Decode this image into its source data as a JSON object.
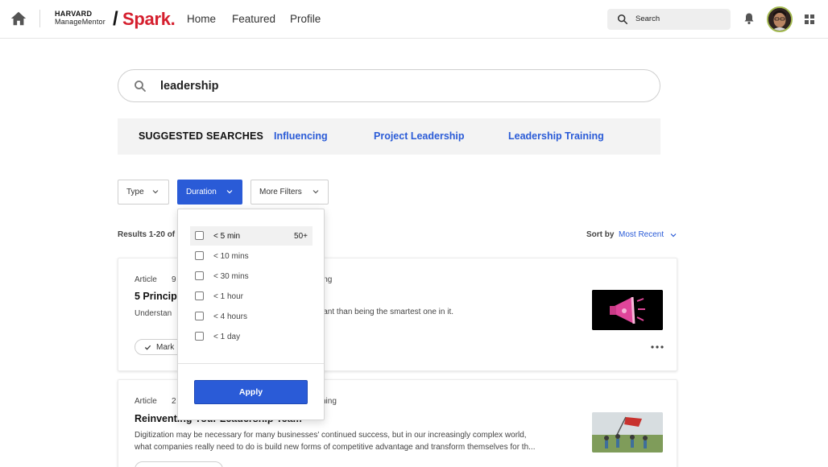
{
  "header": {
    "brand_harvard": "HARVARD",
    "brand_managementor": "ManageMentor",
    "brand_slash": "/",
    "brand_spark": "Spark.",
    "nav": [
      "Home",
      "Featured",
      "Profile"
    ],
    "search_label": "Search"
  },
  "search": {
    "query": "leadership"
  },
  "suggested": {
    "title": "SUGGESTED SEARCHES",
    "links": [
      "Influencing",
      "Project Leadership",
      "Leadership Training"
    ]
  },
  "filters": {
    "type": "Type",
    "duration": "Duration",
    "more": "More Filters"
  },
  "results": {
    "count_text": "Results 1-20 of",
    "sort_label": "Sort by",
    "sort_value": "Most Recent"
  },
  "cards": [
    {
      "type": "Article",
      "meta_start": "9",
      "meta_end": "ing",
      "title": "5 Principl",
      "desc_start": "Understan",
      "desc_end": "portant than being the smartest one in it.",
      "mark_label": "Mark"
    },
    {
      "type": "Article",
      "meta_start": "2",
      "meta_end": "ning",
      "title": "Reinventing Your Leadership Team",
      "desc_line1": "Digitization may be necessary for many businesses' continued success, but in our increasingly complex world,",
      "desc_line2": "what companies really need to do is build new forms of competitive advantage and transform themselves for th..."
    }
  ],
  "duration_dropdown": {
    "options": [
      {
        "label": "< 5 min",
        "count": "50+"
      },
      {
        "label": "< 10 mins",
        "count": ""
      },
      {
        "label": "< 30 mins",
        "count": ""
      },
      {
        "label": "< 1 hour",
        "count": ""
      },
      {
        "label": "< 4 hours",
        "count": ""
      },
      {
        "label": "< 1 day",
        "count": ""
      }
    ],
    "apply_label": "Apply"
  },
  "colors": {
    "accent": "#2a5bd7",
    "brand_red": "#d51f2e"
  }
}
